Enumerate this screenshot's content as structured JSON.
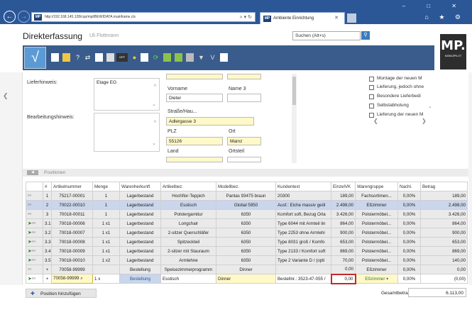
{
  "browser": {
    "url": "http://192.168.145.128/csp/mpl/BEWIDATA.mainframe.cls",
    "address_controls": "⌕ ▾ ↻",
    "tab_title": "Ambiente Einrichtung",
    "favicon": "MP",
    "window_controls": "– □ ✕",
    "bookmarks": "⌂ ★ ⚙"
  },
  "app": {
    "title": "Direkterfassung",
    "user": "Uli Flottmann",
    "search_placeholder": "Suchen (Alt+s)",
    "logo_text": "MP.",
    "logo_sub": "MOBILEPILOT",
    "ok_symbol": "√"
  },
  "form": {
    "lieferhinweis_label": "Lieferhinweis:",
    "lieferhinweis_value": "Etage EG",
    "bearbeitungshinweis_label": "Bearbeitungshinweis:",
    "vorname_label": "Vorname",
    "vorname_value": "Dieter",
    "name3_label": "Name 3",
    "strasse_label": "Straße/Hau...",
    "strasse_value": "Adlergasse 3",
    "plz_label": "PLZ",
    "plz_value": "55126",
    "ort_label": "Ort",
    "ort_value": "Mainz",
    "land_label": "Land",
    "ortsteil_label": "Ortsteil"
  },
  "checkboxes": [
    {
      "label": "Montage der neuen M"
    },
    {
      "label": "Lieferung, jedoch ohne"
    },
    {
      "label": "Besondere Lieferbedi"
    },
    {
      "label": "Selbstabholung"
    },
    {
      "label": "Lieferung der neuen M"
    }
  ],
  "positions": {
    "section_title": "Positionen",
    "headers": [
      "",
      "#",
      "Artikelnummer",
      "Menge",
      "Warenherkunft",
      "Artikelbez.",
      "Modellbez.",
      "Kundentext",
      "EinzelVK",
      "Warengruppe",
      "Nachl.",
      "Betrag"
    ],
    "rows": [
      {
        "style": "gray",
        "num": "1",
        "art": "75217-00001",
        "menge": "1",
        "herkunft": "Lagerbestand",
        "bez": "Hochflor-Teppich",
        "modell": "Pantas 93475 braun",
        "text": "20300",
        "vk": "189,00",
        "gruppe": "Fachsortimen...",
        "nachl": "0,00%",
        "betrag": "189,00"
      },
      {
        "style": "blue",
        "num": "2",
        "art": "70022-00010",
        "menge": "1",
        "herkunft": "Lagerbestand",
        "bez": "Esstisch",
        "modell": "Global 5950",
        "text": "Ausf.: Eiche massiv geöl",
        "vk": "2.498,00",
        "gruppe": "Eßzimmer",
        "nachl": "0,00%",
        "betrag": "2.498,00"
      },
      {
        "style": "gray",
        "num": "3",
        "art": "70018-00011",
        "menge": "1",
        "herkunft": "Lagerbestand",
        "bez": "Polstergarnitur",
        "modell": "6350",
        "text": "Komfort soft, Bezug Orla",
        "vk": "3.426,00",
        "gruppe": "Polstermöbel...",
        "nachl": "0,00%",
        "betrag": "3.426,00"
      },
      {
        "style": "gray",
        "num": "3.1",
        "art": "70018-00006",
        "menge": "1 x1",
        "herkunft": "Lagerbestand",
        "bez": "Longchair",
        "modell": "6350",
        "text": "Type 6044 mit Armteil lin",
        "vk": "864,00",
        "gruppe": "Polstermöbel...",
        "nachl": "0,00%",
        "betrag": "864,00"
      },
      {
        "style": "gray",
        "num": "3.2",
        "art": "70018-00007",
        "menge": "1 x1",
        "herkunft": "Lagerbestand",
        "bez": "2-sitzer Querschläfer",
        "modell": "6350",
        "text": "Type 2253 ohne Armlehi",
        "vk": "900,00",
        "gruppe": "Polstermöbel...",
        "nachl": "0,00%",
        "betrag": "900,00"
      },
      {
        "style": "gray",
        "num": "3.3",
        "art": "70018-00008",
        "menge": "1 x1",
        "herkunft": "Lagerbestand",
        "bez": "Spitzeckteil",
        "modell": "6350",
        "text": "Type 8031 groß / Komfo",
        "vk": "653,00",
        "gruppe": "Polstermöbel...",
        "nachl": "0,00%",
        "betrag": "653,00"
      },
      {
        "style": "gray",
        "num": "3.4",
        "art": "70018-00009",
        "menge": "1 x1",
        "herkunft": "Lagerbestand",
        "bez": "2-sitzer mit Stauraum",
        "modell": "6350",
        "text": "Type 2133 / Komfort soft",
        "vk": "869,00",
        "gruppe": "Polstermöbel...",
        "nachl": "0,00%",
        "betrag": "869,00"
      },
      {
        "style": "gray",
        "num": "3.5",
        "art": "70018-00010",
        "menge": "1 x2",
        "herkunft": "Lagerbestand",
        "bez": "Armlehne",
        "modell": "6350",
        "text": "Type 2 Variante D / (opti",
        "vk": "70,00",
        "gruppe": "Polstermöbel...",
        "nachl": "0,00%",
        "betrag": "140,00"
      },
      {
        "style": "gray",
        "num": "+",
        "art": "70058-99999",
        "menge": "",
        "herkunft": "Bestellung",
        "bez": "Speisezimmerprogramm",
        "modell": "Dinner",
        "text": "",
        "vk": "0,00",
        "gruppe": "Eßzimmer",
        "nachl": "0,00%",
        "betrag": "0,00"
      }
    ],
    "edit_row": {
      "num": "+",
      "art": "70058-99999",
      "menge": "1",
      "unit": "x",
      "herkunft": "Bestellung",
      "bez": "Esstisch",
      "modell": "Dinner",
      "text": "Bestellnr.: 3523-47-055 /",
      "vk": "0,00",
      "gruppe": "Eßzimmer",
      "nachl": "0,00%",
      "betrag": "(0,00)"
    },
    "add_label": "Position hinzufügen",
    "total_label": "Gesamtbetrag",
    "total_value": "6.113,00"
  }
}
